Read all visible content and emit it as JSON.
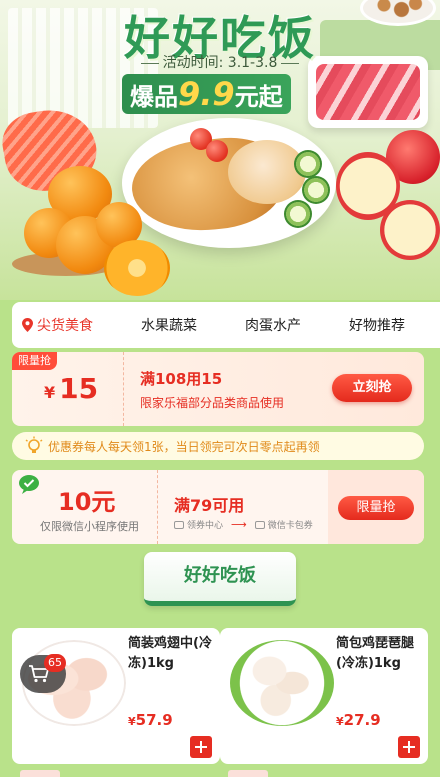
{
  "hero": {
    "title": "好好吃饭",
    "time_label": "活动时间: 3.1-3.8",
    "price_prefix": "爆品",
    "price_value": "9.9",
    "price_suffix": "元起"
  },
  "tabs": [
    {
      "label": "尖货美食",
      "active": true
    },
    {
      "label": "水果蔬菜",
      "active": false
    },
    {
      "label": "肉蛋水产",
      "active": false
    },
    {
      "label": "好物推荐",
      "active": false
    }
  ],
  "coupon1": {
    "flag": "限量抢",
    "currency": "¥",
    "amount": "15",
    "title": "满108用15",
    "desc": "限家乐福部分品类商品使用",
    "button": "立刻抢"
  },
  "notice": {
    "text": "优惠券每人每天领1张，当日领完可次日零点起再领"
  },
  "coupon2": {
    "amount": "10元",
    "desc": "仅限微信小程序使用",
    "title": "满79可用",
    "step1": "领券中心",
    "step2": "微信卡包券",
    "button": "限量抢"
  },
  "section": {
    "title": "好好吃饭"
  },
  "products": [
    {
      "name": "简装鸡翅中(冷冻)1kg",
      "currency": "¥",
      "price": "57.9"
    },
    {
      "name": "简包鸡琵琶腿(冷冻)1kg",
      "currency": "¥",
      "price": "27.9"
    }
  ],
  "cart": {
    "count": "65"
  },
  "colors": {
    "brand_green": "#2e9352",
    "accent_red": "#e62d22",
    "background": "#b9e28a"
  }
}
